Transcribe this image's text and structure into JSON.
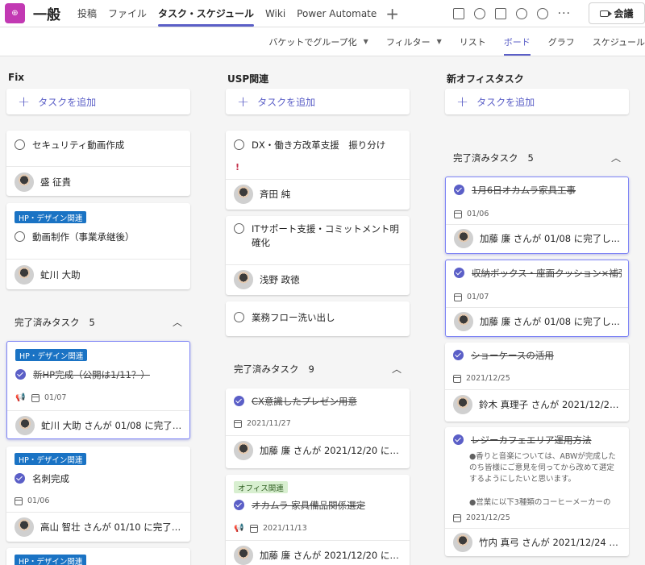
{
  "header": {
    "app_icon_glyph": "⊕",
    "team_name": "一般",
    "tabs": [
      {
        "label": "投稿"
      },
      {
        "label": "ファイル"
      },
      {
        "label": "タスク・スケジュール"
      },
      {
        "label": "Wiki"
      },
      {
        "label": "Power Automate"
      }
    ],
    "add_tab": "+",
    "more": "···",
    "meet_label": "会議"
  },
  "toolbar": {
    "group_by": "バケットでグループ化",
    "filter": "フィルター",
    "views": [
      "リスト",
      "ボード",
      "グラフ",
      "スケジュール"
    ],
    "active_view": "ボード"
  },
  "columns": [
    {
      "title": "Fix",
      "add_task": "タスクを追加",
      "cards": [
        {
          "title": "セキュリティ動画作成",
          "assignee": "盛 征貴"
        },
        {
          "label": "HP・デザイン関連",
          "title": "動画制作（事業承継後）",
          "assignee": "虻川 大助"
        }
      ],
      "completed": {
        "label": "完了済みタスク",
        "count": "5"
      },
      "done_cards": [
        {
          "label": "HP・デザイン関連",
          "title": "新HP完成（公開は1/11？）",
          "date": "01/07",
          "assignee": "虻川 大助 さんが 01/08 に完了し..."
        },
        {
          "label": "HP・デザイン関連",
          "title": "名刺完成",
          "date": "01/06",
          "assignee": "高山 智壮 さんが 01/10 に完了し..."
        },
        {
          "label": "HP・デザイン関連"
        }
      ]
    },
    {
      "title": "USP関連",
      "add_task": "タスクを追加",
      "cards": [
        {
          "title": "DX・働き方改革支援　振り分け",
          "priority": "!",
          "assignee": "斉田 純"
        },
        {
          "title": "ITサポート支援・コミットメント明確化",
          "assignee": "浅野 政徳"
        },
        {
          "title": "業務フロー洗い出し"
        }
      ],
      "completed": {
        "label": "完了済みタスク",
        "count": "9"
      },
      "done_cards": [
        {
          "title": "CX意識したプレゼン用意",
          "date": "2021/11/27",
          "assignee": "加藤 廉 さんが 2021/12/20 に完..."
        },
        {
          "label": "オフィス関連",
          "title": "オカムラ 家具備品関係選定",
          "date": "2021/11/13",
          "assignee": "加藤 廉 さんが 2021/12/20 に完..."
        }
      ]
    },
    {
      "title": "新オフィスタスク",
      "add_task": "タスクを追加",
      "completed": {
        "label": "完了済みタスク",
        "count": "5"
      },
      "done_cards": [
        {
          "title": "1月6日オカムラ家具工事",
          "date": "01/06",
          "assignee": "加藤 廉 さんが 01/08 に完了し..."
        },
        {
          "title": "収納ボックス・座面クッション×補強",
          "date": "01/07",
          "assignee": "加藤 廉 さんが 01/08 に完了し..."
        },
        {
          "title": "ショーケースの活用",
          "date": "2021/12/25",
          "assignee": "鈴木 真理子 さんが 2021/12/24 ..."
        },
        {
          "title": "レジーカフェエリア運用方法",
          "desc1": "●香りと音楽については、ABWが完成したのち皆様にご意見を伺ってから改めて選定するようにしたいと思います。",
          "desc2": "●営業に以下3種類のコーヒーメーカーの",
          "date": "2021/12/25",
          "assignee": "竹内 真弓 さんが 2021/12/24 に..."
        }
      ]
    }
  ]
}
